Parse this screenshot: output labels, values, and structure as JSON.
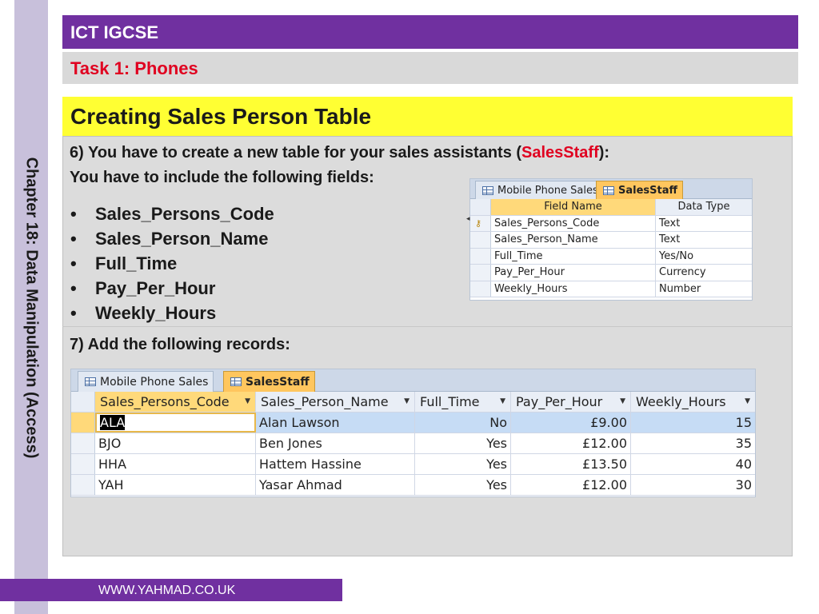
{
  "side_title": "Chapter 18: Data Manipulation (Access)",
  "header": {
    "title": "ICT IGCSE"
  },
  "task": {
    "title": "Task 1: Phones"
  },
  "section": {
    "title": "Creating Sales Person Table"
  },
  "instruction6": {
    "prefix": "6) You have to create a new table for your sales assistants (",
    "highlight": "SalesStaff",
    "suffix": "):",
    "line2": "You have to include the following fields:"
  },
  "bullets": [
    "Sales_Persons_Code",
    "Sales_Person_Name",
    "Full_Time",
    "Pay_Per_Hour",
    "Weekly_Hours"
  ],
  "instruction7": "7) Add the following records:",
  "design_view": {
    "tabs": [
      "Mobile Phone Sales",
      "SalesStaff"
    ],
    "headers": [
      "Field Name",
      "Data Type"
    ],
    "rows": [
      [
        "Sales_Persons_Code",
        "Text"
      ],
      [
        "Sales_Person_Name",
        "Text"
      ],
      [
        "Full_Time",
        "Yes/No"
      ],
      [
        "Pay_Per_Hour",
        "Currency"
      ],
      [
        "Weekly_Hours",
        "Number"
      ]
    ]
  },
  "datasheet": {
    "tabs": [
      "Mobile Phone Sales",
      "SalesStaff"
    ],
    "headers": [
      "Sales_Persons_Code",
      "Sales_Person_Name",
      "Full_Time",
      "Pay_Per_Hour",
      "Weekly_Hours"
    ],
    "rows": [
      [
        "ALA",
        "Alan Lawson",
        "No",
        "£9.00",
        "15"
      ],
      [
        "BJO",
        "Ben Jones",
        "Yes",
        "£12.00",
        "35"
      ],
      [
        "HHA",
        "Hattem Hassine",
        "Yes",
        "£13.50",
        "40"
      ],
      [
        "YAH",
        "Yasar Ahmad",
        "Yes",
        "£12.00",
        "30"
      ]
    ]
  },
  "footer": {
    "text": "WWW.YAHMAD.CO.UK"
  }
}
